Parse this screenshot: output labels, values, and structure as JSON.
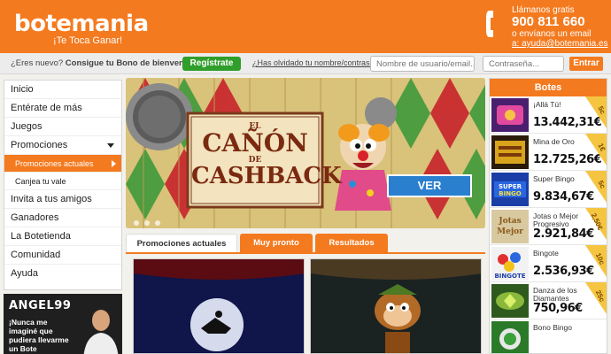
{
  "brand": {
    "logo": "botemania",
    "tagline": "¡Te Toca Ganar!"
  },
  "contact": {
    "label": "Llámanos gratis",
    "phone": "900 811 660",
    "or_email": "o envíanos un email",
    "email": "a: ayuda@botemania.es"
  },
  "login": {
    "question": "¿Eres nuevo?",
    "offer": "Consigue tu Bono de bienvenida",
    "register_label": "Regístrate",
    "forgot_label": "¿Has olvidado tu nombre/contraseña?",
    "user_placeholder": "Nombre de usuario/email...",
    "pass_placeholder": "Contraseña...",
    "enter_label": "Entrar"
  },
  "sidebar": {
    "items": [
      {
        "label": "Inicio"
      },
      {
        "label": "Entérate de más"
      },
      {
        "label": "Juegos"
      },
      {
        "label": "Promociones"
      }
    ],
    "subitems": [
      {
        "label": "Promociones actuales",
        "active": true
      },
      {
        "label": "Canjea tu vale",
        "active": false
      }
    ],
    "items2": [
      {
        "label": "Invita a tus amigos"
      },
      {
        "label": "Ganadores"
      },
      {
        "label": "La Botetienda"
      },
      {
        "label": "Comunidad"
      },
      {
        "label": "Ayuda"
      }
    ]
  },
  "angel_promo": {
    "name": "ANGEL99",
    "text": "¡Nunca me imaginé que pudiera llevarme un Bote"
  },
  "banner": {
    "title_el": "EL",
    "title_canon": "CAÑÓN",
    "title_de": "DE",
    "title_cashback": "CASHBACK",
    "cta_label": "VER"
  },
  "tabs": [
    {
      "label": "Promociones actuales",
      "active": true
    },
    {
      "label": "Muy pronto",
      "active": false
    },
    {
      "label": "Resultados",
      "active": false
    }
  ],
  "botes": {
    "title": "Botes",
    "items": [
      {
        "name": "¡Allá Tú!",
        "amount": "13.442,31€",
        "price": "5c",
        "icon": "alla-tu-thumb"
      },
      {
        "name": "Mina de Oro",
        "amount": "12.725,26€",
        "price": "1€",
        "icon": "mina-de-oro-thumb"
      },
      {
        "name": "Super Bingo",
        "amount": "9.834,67€",
        "price": "5c",
        "icon": "super-bingo-thumb"
      },
      {
        "name": "Jotas o Mejor Progresivo",
        "amount": "2.921,84€",
        "price": "2,50€",
        "icon": "jotas-o-mejor-thumb"
      },
      {
        "name": "Bingote",
        "amount": "2.536,93€",
        "price": "10c",
        "icon": "bingote-thumb"
      },
      {
        "name": "Danza de los Diamantes",
        "amount": "750,96€",
        "price": "25c",
        "icon": "danza-diamantes-thumb"
      },
      {
        "name": "Bono Bingo",
        "amount": "",
        "price": "",
        "icon": "bono-bingo-thumb"
      }
    ]
  },
  "colors": {
    "brand_orange": "#f47a1f",
    "register_green": "#2f9e2a"
  }
}
